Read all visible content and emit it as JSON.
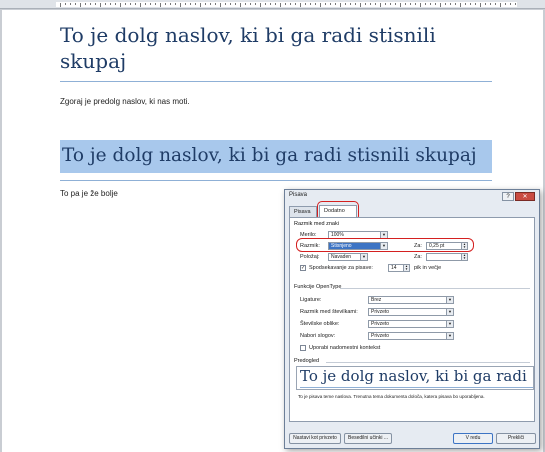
{
  "document": {
    "heading1": "To je dolg naslov, ki bi ga radi stisnili skupaj",
    "body1": "Zgoraj je predolg naslov, ki nas moti.",
    "heading2": "To je dolg naslov, ki bi ga radi stisnili skupaj",
    "body2": "To pa je že bolje"
  },
  "dialog": {
    "title": "Pisava",
    "help": "?",
    "close": "✕",
    "tabs": [
      "Pisava",
      "Dodatno"
    ],
    "section_spacing": "Razmik med znaki",
    "scale_label": "Merilo:",
    "scale_value": "100%",
    "spacing_label": "Razmik:",
    "spacing_value": "Stisnjeno",
    "by_label": "Za:",
    "by_value": "0,25 pt",
    "position_label": "Položaj:",
    "position_value": "Navaden",
    "position_by_label": "Za:",
    "position_by_value": "",
    "kerning_label": "Spodsekavanje za pisave:",
    "kerning_value": "14",
    "kerning_suffix": "pik in večje",
    "section_opentype": "Funkcije OpenType",
    "ligatures_label": "Ligature:",
    "ligatures_value": "Brez",
    "num_spacing_label": "Razmik med številkami:",
    "num_spacing_value": "Privzeto",
    "num_forms_label": "Številske oblike:",
    "num_forms_value": "Privzeto",
    "stylistic_label": "Nabori slogov:",
    "stylistic_value": "Privzeto",
    "contextual_label": "Uporabi nadomestni kontekst",
    "section_preview": "Predogled",
    "preview_text": "To je dolg naslov, ki bi ga radi",
    "preview_desc": "To je pisava teme naslova. Trenutna tema dokumenta določa, katera pisava bo uporabljena.",
    "btn_default": "Nastavi kot privzeto",
    "btn_effects": "Besedilni učinki ...",
    "btn_ok": "V redu",
    "btn_cancel": "Prekliči"
  },
  "colors": {
    "heading": "#1f3c66",
    "selection": "#a8c8ec",
    "annotation": "#d42020"
  }
}
